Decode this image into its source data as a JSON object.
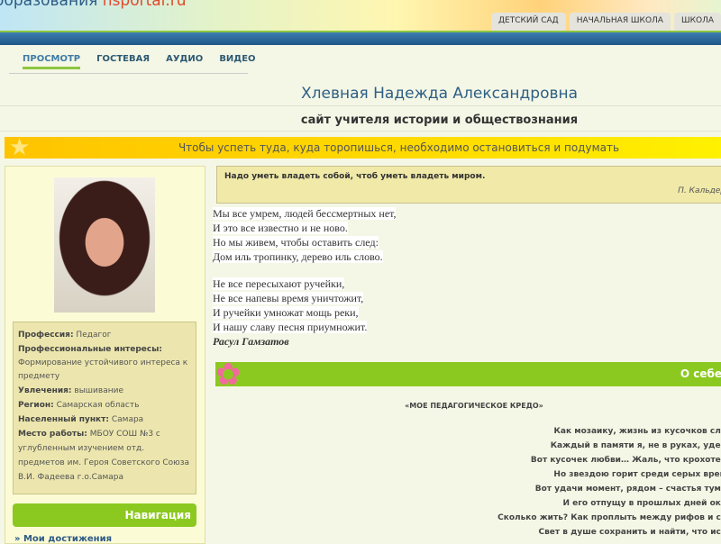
{
  "header": {
    "logo_text": "образования ",
    "logo_brand": "nsportal.ru",
    "top_tabs": [
      "ДЕТСКИЙ САД",
      "НАЧАЛЬНАЯ ШКОЛА",
      "ШКОЛА"
    ]
  },
  "nav": {
    "tabs": [
      "ПРОСМОТР",
      "ГОСТЕВАЯ",
      "АУДИО",
      "ВИДЕО"
    ],
    "active": "ПРОСМОТР"
  },
  "page": {
    "name": "Хлевная Надежда Александровна",
    "subtitle": "сайт учителя истории и обществознания",
    "motto": "Чтобы успеть туда, куда торопишься, необходимо остановиться и подумать"
  },
  "profile": {
    "profession_label": "Профессия:",
    "profession": "Педагог",
    "interests_label": "Профессиональные интересы:",
    "interests": "Формирование устойчивого интереса к предмету",
    "hobby_label": "Увлечения:",
    "hobby": "вышивание",
    "region_label": "Регион:",
    "region": "Самарская область",
    "city_label": "Населенный пункт:",
    "city": "Самара",
    "work_label": "Место работы:",
    "work": "МБОУ СОШ №3 с углубленным изучением отд. предметов им. Героя Советского Союза В.И. Фадеева г.о.Самара"
  },
  "sidebar": {
    "nav_title": "Навигация",
    "links": [
      "Мои достижения"
    ]
  },
  "quote": {
    "text": "Надо уметь владеть собой, чтоб уметь владеть миром.",
    "author": "П. Кальдер"
  },
  "poem": {
    "stanza1": [
      "Мы все умрем, людей бессмертных нет,",
      "И это все известно и не ново.",
      "Но мы живем, чтобы оставить след:",
      "Дом иль тропинку, дерево иль слово."
    ],
    "stanza2": [
      "Не все пересыхают ручейки,",
      "Не все напевы время уничтожит,",
      "И ручейки умножат мощь реки,",
      "И нашу славу песня приумножит."
    ],
    "author": "Расул Гамзатов"
  },
  "about": {
    "title": "О себе",
    "credo_title": "«МОЕ ПЕДАГОГИЧЕСКОЕ КРЕДО»",
    "credo_lines": [
      "Как мозаику, жизнь из кусочков сло",
      "Каждый в памяти я, не в руках, удер",
      "Вот кусочек любви… Жаль, что крохотен",
      "Но звездою горит среди серых врем",
      "Вот удачи момент, рядом – счастья тума",
      "И его отпущу в прошлых дней оке",
      "Сколько жить? Как проплыть между рифов и ск",
      "Свет в душе сохранить и найти, что иск"
    ]
  }
}
